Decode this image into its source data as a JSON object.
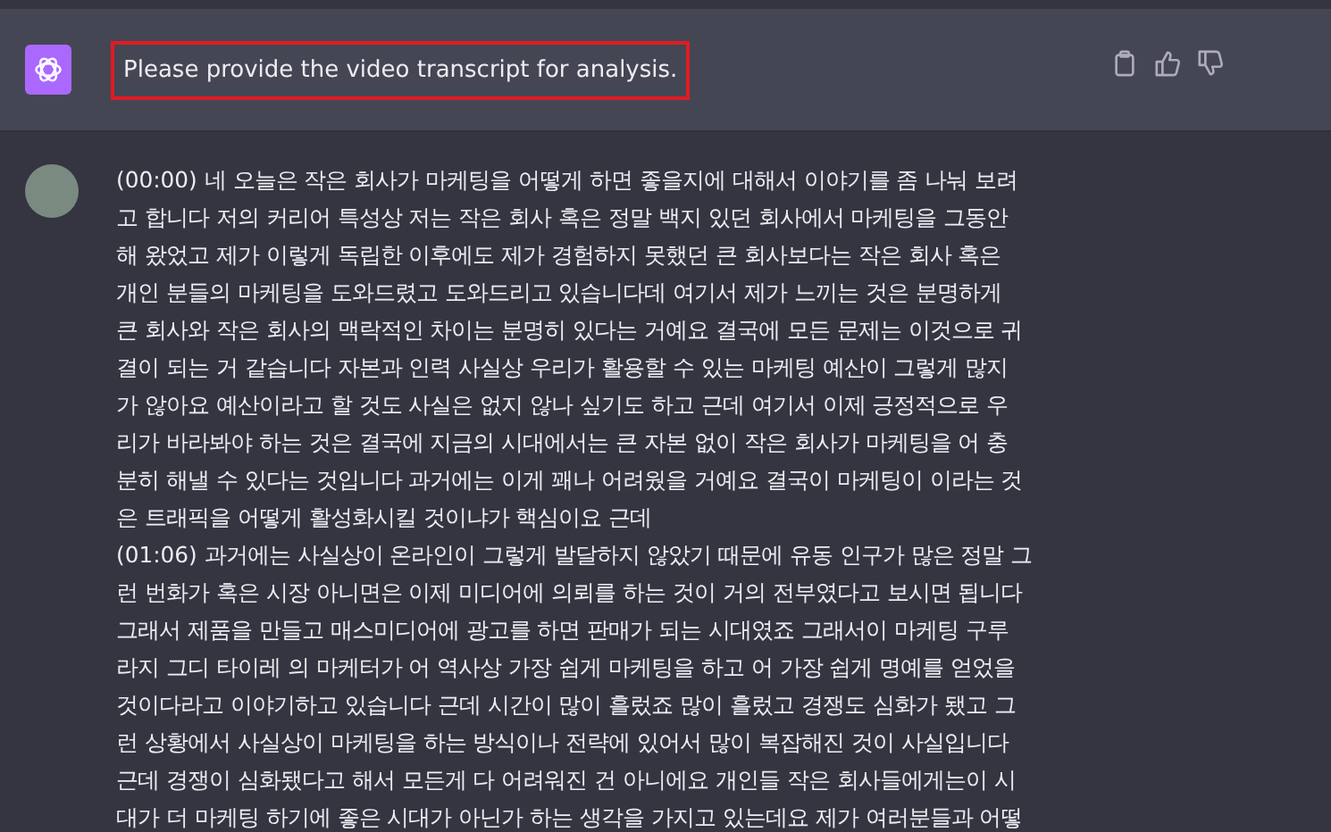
{
  "assistant_message": {
    "text": "Please provide the video transcript for analysis.",
    "highlighted": true
  },
  "user_message": {
    "paragraphs": [
      {
        "lines": [
          "(00:00) 네 오늘은 작은 회사가 마케팅을 어떻게 하면 좋을지에 대해서 이야기를 좀 나눠 보려",
          "고 합니다 저의 커리어 특성상 저는 작은 회사 혹은 정말 백지 있던 회사에서 마케팅을 그동안",
          "해 왔었고 제가 이렇게 독립한 이후에도 제가 경험하지 못했던 큰 회사보다는 작은 회사 혹은",
          "개인 분들의 마케팅을 도와드렸고 도와드리고 있습니다데 여기서 제가 느끼는 것은 분명하게",
          "큰 회사와 작은 회사의 맥락적인 차이는 분명히 있다는 거예요 결국에 모든 문제는 이것으로 귀",
          "결이 되는 거 같습니다 자본과 인력 사실상 우리가 활용할 수 있는 마케팅 예산이 그렇게 많지",
          "가 않아요 예산이라고 할 것도 사실은 없지 않나 싶기도 하고 근데 여기서 이제 긍정적으로 우",
          "리가 바라봐야 하는 것은 결국에 지금의 시대에서는 큰 자본 없이 작은 회사가 마케팅을 어 충",
          "분히 해낼 수 있다는 것입니다 과거에는 이게 꽤나 어려웠을 거예요 결국이 마케팅이 이라는 것",
          "은 트래픽을 어떻게 활성화시킬 것이냐가 핵심이요 근데"
        ]
      },
      {
        "lines": [
          "(01:06) 과거에는 사실상이 온라인이 그렇게 발달하지 않았기 때문에 유동 인구가 많은 정말 그",
          "런 번화가 혹은 시장 아니면은 이제 미디어에 의뢰를 하는 것이 거의 전부였다고 보시면 됩니다",
          "그래서 제품을 만들고 매스미디어에 광고를 하면 판매가 되는 시대였죠 그래서이 마케팅 구루",
          "라지 그디 타이레 의 마케터가 어 역사상 가장 쉽게 마케팅을 하고 어 가장 쉽게 명예를 얻었을",
          "것이다라고 이야기하고 있습니다 근데 시간이 많이 흘렀죠 많이 흘렀고 경쟁도 심화가 됐고 그",
          "런 상황에서 사실상이 마케팅을 하는 방식이나 전략에 있어서 많이 복잡해진 것이 사실입니다",
          "근데 경쟁이 심화됐다고 해서 모든게 다 어려워진 건 아니에요 개인들 작은 회사들에게는이 시",
          "대가 더 마케팅 하기에 좋은 시대가 아닌가 하는 생각을 가지고 있는데요 제가 여러분들과 어떻"
        ]
      }
    ]
  }
}
